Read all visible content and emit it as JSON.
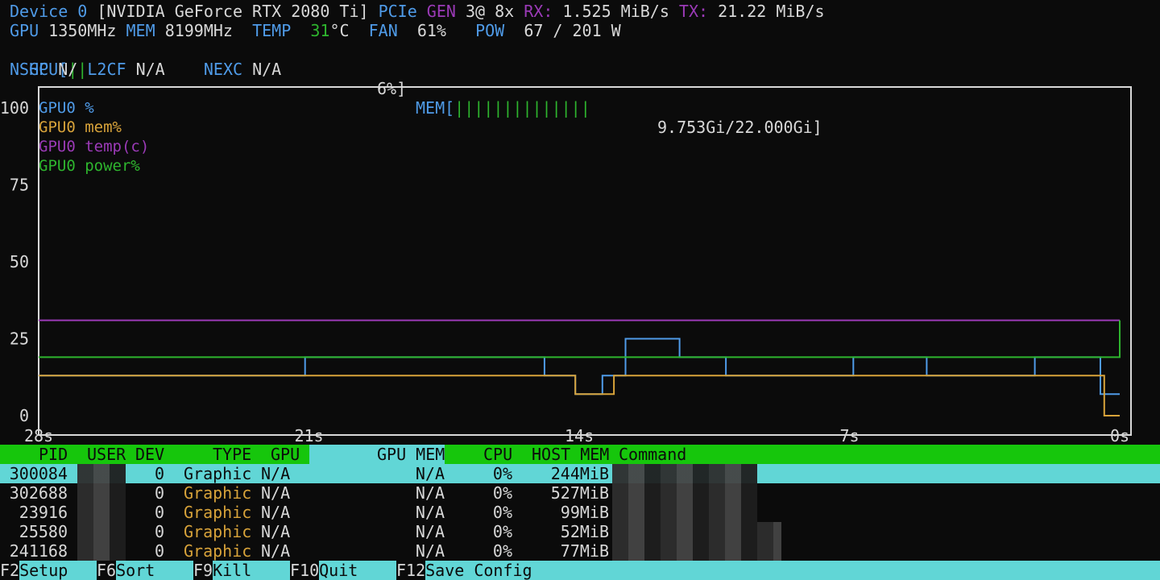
{
  "device": {
    "device_label": "Device 0",
    "name": "[NVIDIA GeForce RTX 2080 Ti]",
    "pcie_label": "PCIe",
    "gen_label": "GEN",
    "gen_value": "3@ 8x",
    "rx_label": "RX:",
    "rx_value": "1.525 MiB/s",
    "tx_label": "TX:",
    "tx_value": "21.22 MiB/s",
    "gpu_label": "GPU",
    "gpu_clock": "1350MHz",
    "mem_label": "MEM",
    "mem_clock": "8199MHz",
    "temp_label": "TEMP",
    "temp_value": "31",
    "temp_unit": "°C",
    "fan_label": "FAN",
    "fan_value": "61%",
    "pow_label": "POW",
    "pow_value": "67 / 201 W",
    "gpu_bar_label": "GPU[",
    "gpu_bar_ticks": "||",
    "gpu_bar_value": "6%]",
    "gpu_util_fraction": 0.06,
    "mem_bar_label": "MEM[",
    "mem_bar_ticks": "||||||||||||||",
    "mem_bar_value": "9.753Gi/22.000Gi]",
    "mem_used_fraction": 0.443,
    "nshc_label": "NSHC",
    "nshc_value": "N/",
    "l2cf_label": "L2CF",
    "l2cf_value": "N/A",
    "nexc_label": "NEXC",
    "nexc_value": "N/A"
  },
  "chart_data": {
    "type": "line",
    "ylim": [
      0,
      100
    ],
    "y_ticks": [
      "100",
      "75",
      "50",
      "25",
      "0"
    ],
    "x_ticks": [
      "28s",
      "21s",
      "14s",
      "7s",
      "0s"
    ],
    "x_range_seconds": [
      28,
      0
    ],
    "legend_placement": "top-left",
    "series": [
      {
        "name": "GPU0 %",
        "color": "#4f9be8",
        "points": [
          [
            28,
            13
          ],
          [
            21.1,
            13
          ],
          [
            21.1,
            19
          ],
          [
            14.9,
            19
          ],
          [
            14.9,
            13
          ],
          [
            14.1,
            13
          ],
          [
            14.1,
            7
          ],
          [
            13.4,
            7
          ],
          [
            13.4,
            13
          ],
          [
            12.8,
            13
          ],
          [
            12.8,
            25
          ],
          [
            11.4,
            25
          ],
          [
            11.4,
            19
          ],
          [
            10.2,
            19
          ],
          [
            10.2,
            13
          ],
          [
            6.9,
            13
          ],
          [
            6.9,
            19
          ],
          [
            5.0,
            19
          ],
          [
            5.0,
            13
          ],
          [
            2.2,
            13
          ],
          [
            2.2,
            19
          ],
          [
            0.5,
            19
          ],
          [
            0.5,
            7
          ],
          [
            0,
            7
          ]
        ]
      },
      {
        "name": "GPU0 mem%",
        "color": "#d8a33a",
        "points": [
          [
            28,
            13
          ],
          [
            14.1,
            13
          ],
          [
            14.1,
            7
          ],
          [
            13.1,
            7
          ],
          [
            13.1,
            13
          ],
          [
            0.4,
            13
          ],
          [
            0.4,
            0
          ],
          [
            0,
            0
          ]
        ]
      },
      {
        "name": "GPU0 temp(c)",
        "color": "#9b3ab7",
        "points": [
          [
            28,
            31
          ],
          [
            0,
            31
          ]
        ]
      },
      {
        "name": "GPU0 power%",
        "color": "#2eb52e",
        "points": [
          [
            28,
            19
          ],
          [
            0,
            19
          ],
          [
            0,
            31
          ]
        ]
      }
    ]
  },
  "process_table": {
    "headers": {
      "pid": "PID",
      "user": "USER",
      "dev": "DEV",
      "type": "TYPE",
      "gpu": "GPU",
      "gpu_mem": "GPU MEM",
      "cpu": "CPU",
      "host_mem": "HOST MEM",
      "command": "Command"
    },
    "rows": [
      {
        "pid": "300084",
        "dev": "0",
        "type": "Graphic",
        "gpu": "N/A",
        "gpu_mem": "N/A",
        "cpu": "0%",
        "host_mem": "244MiB"
      },
      {
        "pid": "302688",
        "dev": "0",
        "type": "Graphic",
        "gpu": "N/A",
        "gpu_mem": "N/A",
        "cpu": "0%",
        "host_mem": "527MiB"
      },
      {
        "pid": "23916",
        "dev": "0",
        "type": "Graphic",
        "gpu": "N/A",
        "gpu_mem": "N/A",
        "cpu": "0%",
        "host_mem": "99MiB"
      },
      {
        "pid": "25580",
        "dev": "0",
        "type": "Graphic",
        "gpu": "N/A",
        "gpu_mem": "N/A",
        "cpu": "0%",
        "host_mem": "52MiB"
      },
      {
        "pid": "241168",
        "dev": "0",
        "type": "Graphic",
        "gpu": "N/A",
        "gpu_mem": "N/A",
        "cpu": "0%",
        "host_mem": "77MiB"
      }
    ]
  },
  "footer": {
    "setup_key": "F2",
    "setup_label": "Setup",
    "sort_key": "F6",
    "sort_label": "Sort",
    "kill_key": "F9",
    "kill_label": "Kill",
    "quit_key": "F10",
    "quit_label": "Quit",
    "save_key": "F12",
    "save_label": "Save Config"
  }
}
